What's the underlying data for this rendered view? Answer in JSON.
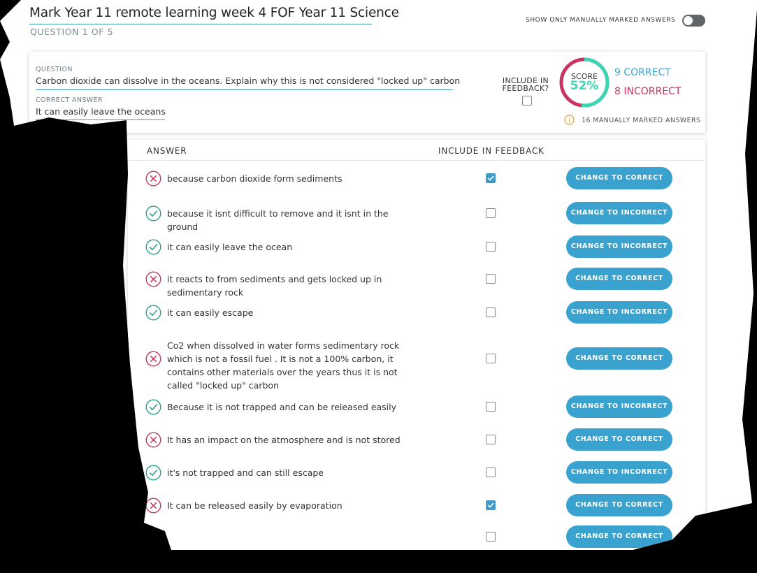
{
  "header": {
    "title": "Mark Year 11 remote learning week 4 FOF Year 11 Science",
    "question_counter": "QUESTION 1 OF 5",
    "toggle_label": "SHOW ONLY MANUALLY MARKED ANSWERS",
    "toggle_on": false
  },
  "question": {
    "label": "QUESTION",
    "text": "Carbon dioxide can dissolve in the oceans. Explain why this is not considered \"locked up\" carbon",
    "correct_answer_label": "CORRECT ANSWER",
    "correct_answer": "It can easily leave the oceans",
    "include_feedback_label": "INCLUDE IN FEEDBACK?",
    "include_feedback_checked": false,
    "score_label": "SCORE",
    "score_value": "52%",
    "score_fraction": 0.52,
    "correct_count": "9 CORRECT",
    "incorrect_count": "8 INCORRECT",
    "manual_marked": "16 MANUALLY MARKED ANSWERS"
  },
  "colors": {
    "correct": "#2a9d8f",
    "incorrect": "#c8345f",
    "accent": "#3aa2cf",
    "score_teal": "#3dd6b4"
  },
  "answers_table": {
    "col_answer": "ANSWER",
    "col_feedback": "INCLUDE IN FEEDBACK",
    "rows": [
      {
        "status": "incorrect",
        "text": "because carbon dioxide form sediments",
        "include": true,
        "button": "CHANGE TO CORRECT"
      },
      {
        "status": "correct",
        "text": "because it isnt difficult to remove and it isnt in the ground",
        "include": false,
        "button": "CHANGE TO INCORRECT"
      },
      {
        "status": "correct",
        "text": "it can  easily leave the ocean",
        "include": false,
        "button": "CHANGE TO INCORRECT"
      },
      {
        "status": "incorrect",
        "text": "it reacts to from sediments and gets locked up in sedimentary rock",
        "include": false,
        "button": "CHANGE TO CORRECT"
      },
      {
        "status": "correct",
        "text": "it can easily escape",
        "include": false,
        "button": "CHANGE TO INCORRECT"
      },
      {
        "status": "incorrect",
        "text": "Co2 when dissolved in water forms sedimentary rock which is not a fossil fuel . It is not a 100% carbon, it contains other materials over the years thus it is not called \"locked up\" carbon",
        "include": false,
        "button": "CHANGE TO CORRECT"
      },
      {
        "status": "correct",
        "text": "Because it is not trapped and can be released easily",
        "include": false,
        "button": "CHANGE TO INCORRECT"
      },
      {
        "status": "incorrect",
        "text": "It has an impact on the atmosphere and is not stored",
        "include": false,
        "button": "CHANGE TO CORRECT"
      },
      {
        "status": "correct",
        "text": "it's not trapped and can still escape",
        "include": false,
        "button": "CHANGE TO INCORRECT"
      },
      {
        "status": "incorrect",
        "text": "It can be released easily by evaporation",
        "include": true,
        "button": "CHANGE TO CORRECT"
      },
      {
        "status": "correct",
        "text": "",
        "include": false,
        "button": "CHANGE TO CORRECT"
      }
    ]
  }
}
